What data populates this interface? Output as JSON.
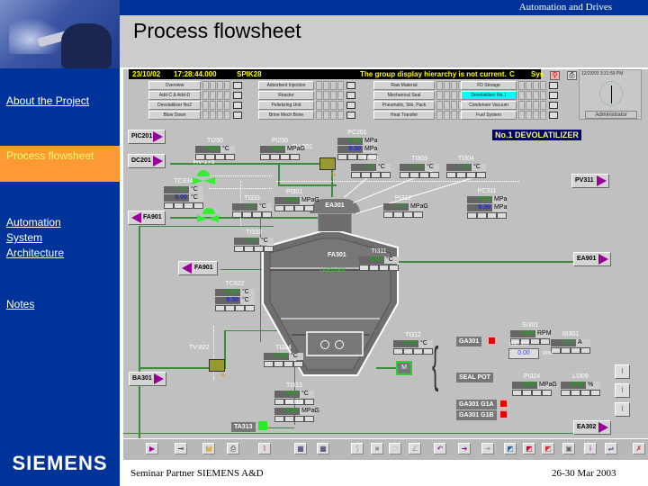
{
  "header": {
    "brand_text": "Automation and Drives",
    "title": "Process flowsheet"
  },
  "sidebar": {
    "items": [
      {
        "label": "About the Project",
        "active": false
      },
      {
        "label": "Process flowsheet",
        "active": true
      },
      {
        "label": "Automation System Architecture",
        "active": false
      },
      {
        "label": "Notes",
        "active": false
      }
    ],
    "logo": "SIEMENS"
  },
  "hmi": {
    "date": "23/10/02",
    "time": "17:28:44.000",
    "station": "SPIK28",
    "message": "The group display hierarchy is not current.",
    "msg_code": "C",
    "sys_label": "Sys",
    "clock_text": "12/23/03 3:31:59 PM",
    "user": "Administrator",
    "nav_buttons": [
      [
        "Overview",
        "Adsorbent Injection",
        "Raw Material",
        "FD Storage"
      ],
      [
        "Add-C & Add-D",
        "Reactor",
        "Mechanical Seal",
        "Devolatilizer No.1"
      ],
      [
        "Devolatilizer No2",
        "Pelletizing Unit",
        "Pneumatic, Silo, Pack",
        "Condenser Vacuum"
      ],
      [
        "Blow Down",
        "Brine Mech Brine",
        "Heat Transfer",
        "Fuel System"
      ]
    ],
    "selected_button": "Devolatilizer No.1",
    "unit_title": "No.1 DEVOLATILIZER",
    "nav_tags": {
      "PIC201": "PIC201",
      "DC201": "DC201",
      "FA901_top": "FA901",
      "FA901_mid": "FA901",
      "BA301": "BA301",
      "PV311": "PV311",
      "EA901": "EA901",
      "EA302": "EA302"
    },
    "equipment": {
      "EA301": "EA301",
      "FA301": "FA301",
      "motor": "M",
      "level": "LI-301-302"
    },
    "valves": {
      "PV201": "PV-201",
      "HV175": "HV-175",
      "TV334": "TV334",
      "TV822": "TV-822"
    },
    "faceplates": [
      {
        "tag": "TI250",
        "value": "0.00",
        "unit": "°C"
      },
      {
        "tag": "PI250",
        "value": "0.00",
        "unit": "MPaG"
      },
      {
        "tag": "PC201",
        "value": "0.00",
        "sp": "0.00",
        "unit": "MPa"
      },
      {
        "tag": "TI301",
        "value": "0.00",
        "unit": "°C"
      },
      {
        "tag": "TI303",
        "value": "0.00",
        "unit": "°C"
      },
      {
        "tag": "TI304",
        "value": "0.00",
        "unit": "°C"
      },
      {
        "tag": "TC334",
        "value": "0.00",
        "sp": "0.00",
        "unit": "°C"
      },
      {
        "tag": "TI333",
        "value": "0.00",
        "unit": "°C"
      },
      {
        "tag": "PI301",
        "value": "0.00",
        "unit": "MPaG"
      },
      {
        "tag": "PI312",
        "value": "0.00",
        "unit": "MPaG"
      },
      {
        "tag": "PC311",
        "value": "0.00",
        "sp": "0.00",
        "unit": "MPa"
      },
      {
        "tag": "TI332",
        "value": "0.00",
        "unit": "°C"
      },
      {
        "tag": "TI311",
        "value": "0.00",
        "unit": "°C"
      },
      {
        "tag": "TC822",
        "value": "0.00",
        "sp": "0.00",
        "unit": "°C"
      },
      {
        "tag": "TI324",
        "value": "0.00",
        "unit": "°C"
      },
      {
        "tag": "TI313",
        "value": "0.00",
        "unit": "°C"
      },
      {
        "tag": "PI313",
        "value": "0.00",
        "unit": "MPaG"
      },
      {
        "tag": "TI312",
        "value": "0.00",
        "unit": "°C"
      },
      {
        "tag": "SI301",
        "value": "0.00",
        "unit": "RPM"
      },
      {
        "tag": "IS301",
        "value": "0.00",
        "unit": "A"
      },
      {
        "tag": "PI324",
        "value": "0.00",
        "unit": "MPaG"
      },
      {
        "tag": "LI309",
        "value": "0.00",
        "unit": "%"
      }
    ],
    "hic301": {
      "tag": "HIC 301",
      "value": "0.00",
      "unit": "RPM"
    },
    "valve_pct": {
      "PV201": "%",
      "TV822": "%"
    },
    "status_labels": {
      "GA301": "GA301",
      "seal_pot": "SEAL POT",
      "GA301G1A": "GA301 G1A",
      "GA301G1B": "GA301 G1B",
      "TA313": "TA313"
    }
  },
  "footer": {
    "left": "Seminar Partner SIEMENS A&D",
    "right": "26-30 Mar 2003"
  }
}
